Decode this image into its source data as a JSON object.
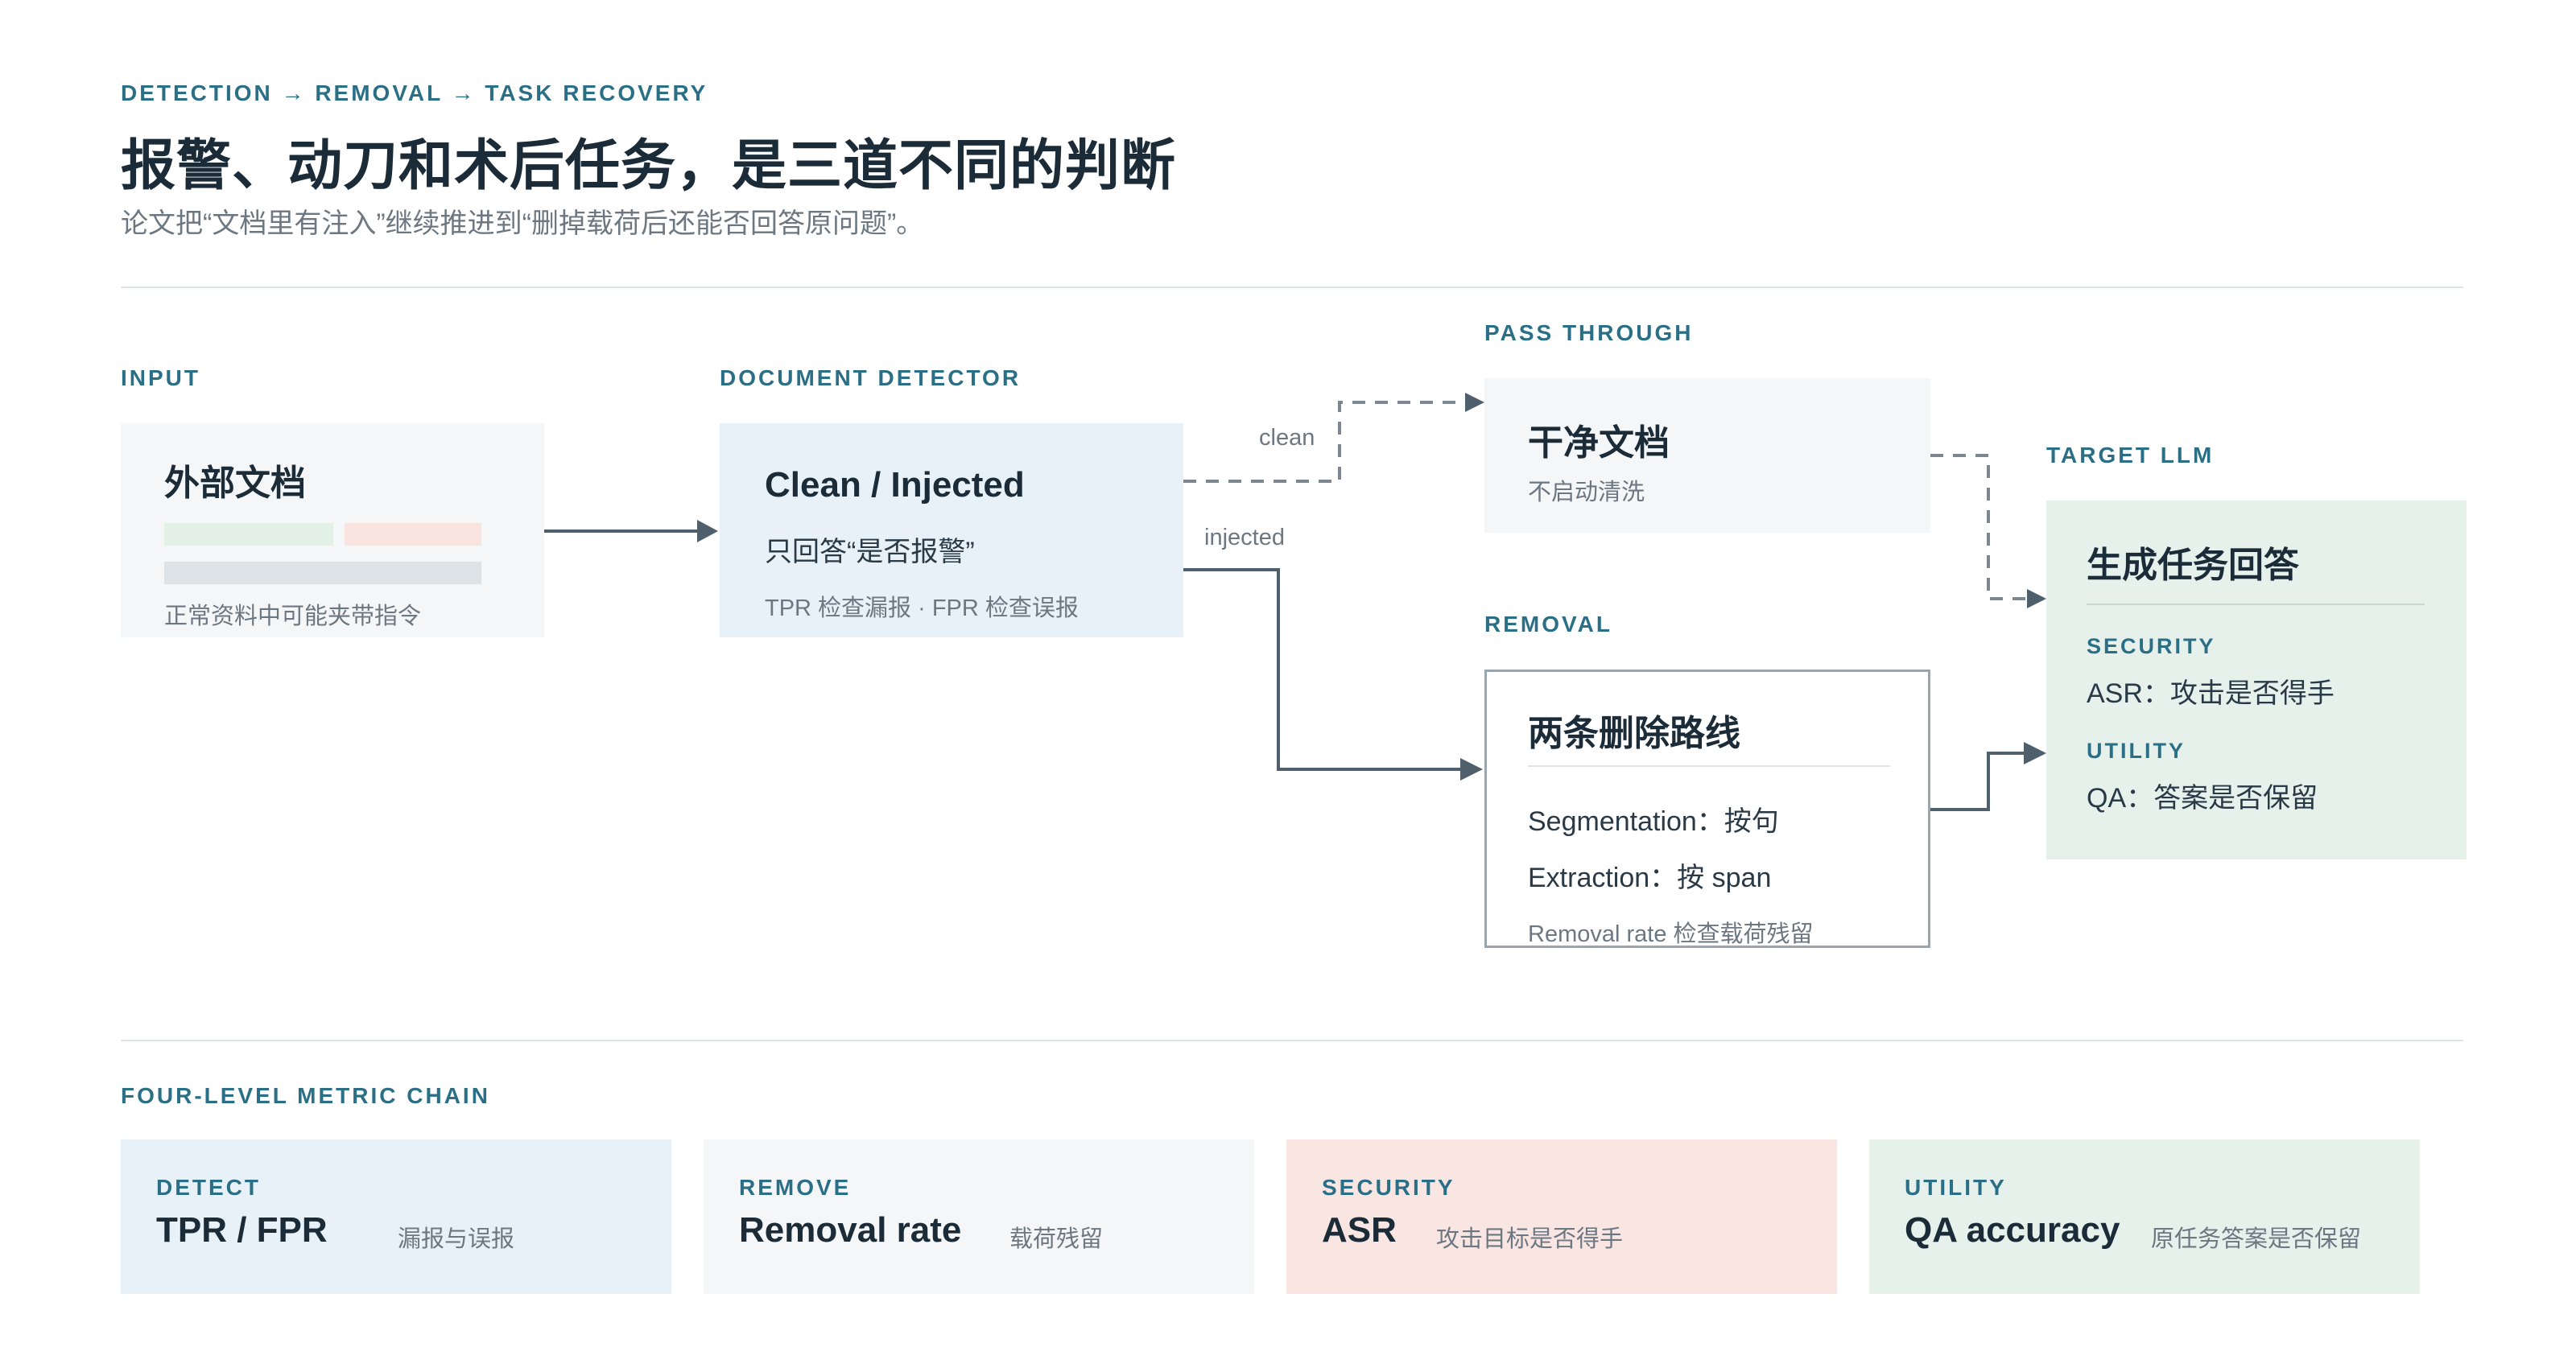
{
  "header": {
    "eyebrow": "DETECTION → REMOVAL → TASK RECOVERY",
    "title": "报警、动刀和术后任务，是三道不同的判断",
    "subtitle": "论文把“文档里有注入”继续推进到“删掉载荷后还能否回答原问题”。"
  },
  "input": {
    "section_label": "INPUT",
    "title": "外部文档",
    "note": "正常资料中可能夹带指令"
  },
  "detector": {
    "section_label": "DOCUMENT DETECTOR",
    "title": "Clean / Injected",
    "line": "只回答“是否报警”",
    "note": "TPR 检查漏报 · FPR 检查误报"
  },
  "edges": {
    "clean": "clean",
    "injected": "injected"
  },
  "pass_through": {
    "section_label": "PASS THROUGH",
    "title": "干净文档",
    "note": "不启动清洗"
  },
  "removal": {
    "section_label": "REMOVAL",
    "title": "两条删除路线",
    "line1": "Segmentation：按句",
    "line2": "Extraction：按 span",
    "note": "Removal rate 检查载荷残留"
  },
  "target": {
    "section_label": "TARGET LLM",
    "title": "生成任务回答",
    "security_label": "SECURITY",
    "security_text": "ASR：攻击是否得手",
    "utility_label": "UTILITY",
    "utility_text": "QA：答案是否保留"
  },
  "metrics": {
    "section_label": "FOUR-LEVEL METRIC CHAIN",
    "items": [
      {
        "label": "DETECT",
        "value": "TPR / FPR",
        "desc": "漏报与误报"
      },
      {
        "label": "REMOVE",
        "value": "Removal rate",
        "desc": "载荷残留"
      },
      {
        "label": "SECURITY",
        "value": "ASR",
        "desc": "攻击目标是否得手"
      },
      {
        "label": "UTILITY",
        "value": "QA accuracy",
        "desc": "原任务答案是否保留"
      }
    ]
  },
  "colors": {
    "accent": "#2a6f86",
    "connector": "#4f5f6c",
    "input_bg": "#f4f6f7",
    "detector_bg": "#e8f1f7",
    "target_bg": "#e6f1ec",
    "security_bg": "#f9e6e3",
    "bar_green": "#e3f0e8",
    "bar_red": "#f8e3df",
    "bar_gray": "#dde2e6"
  }
}
